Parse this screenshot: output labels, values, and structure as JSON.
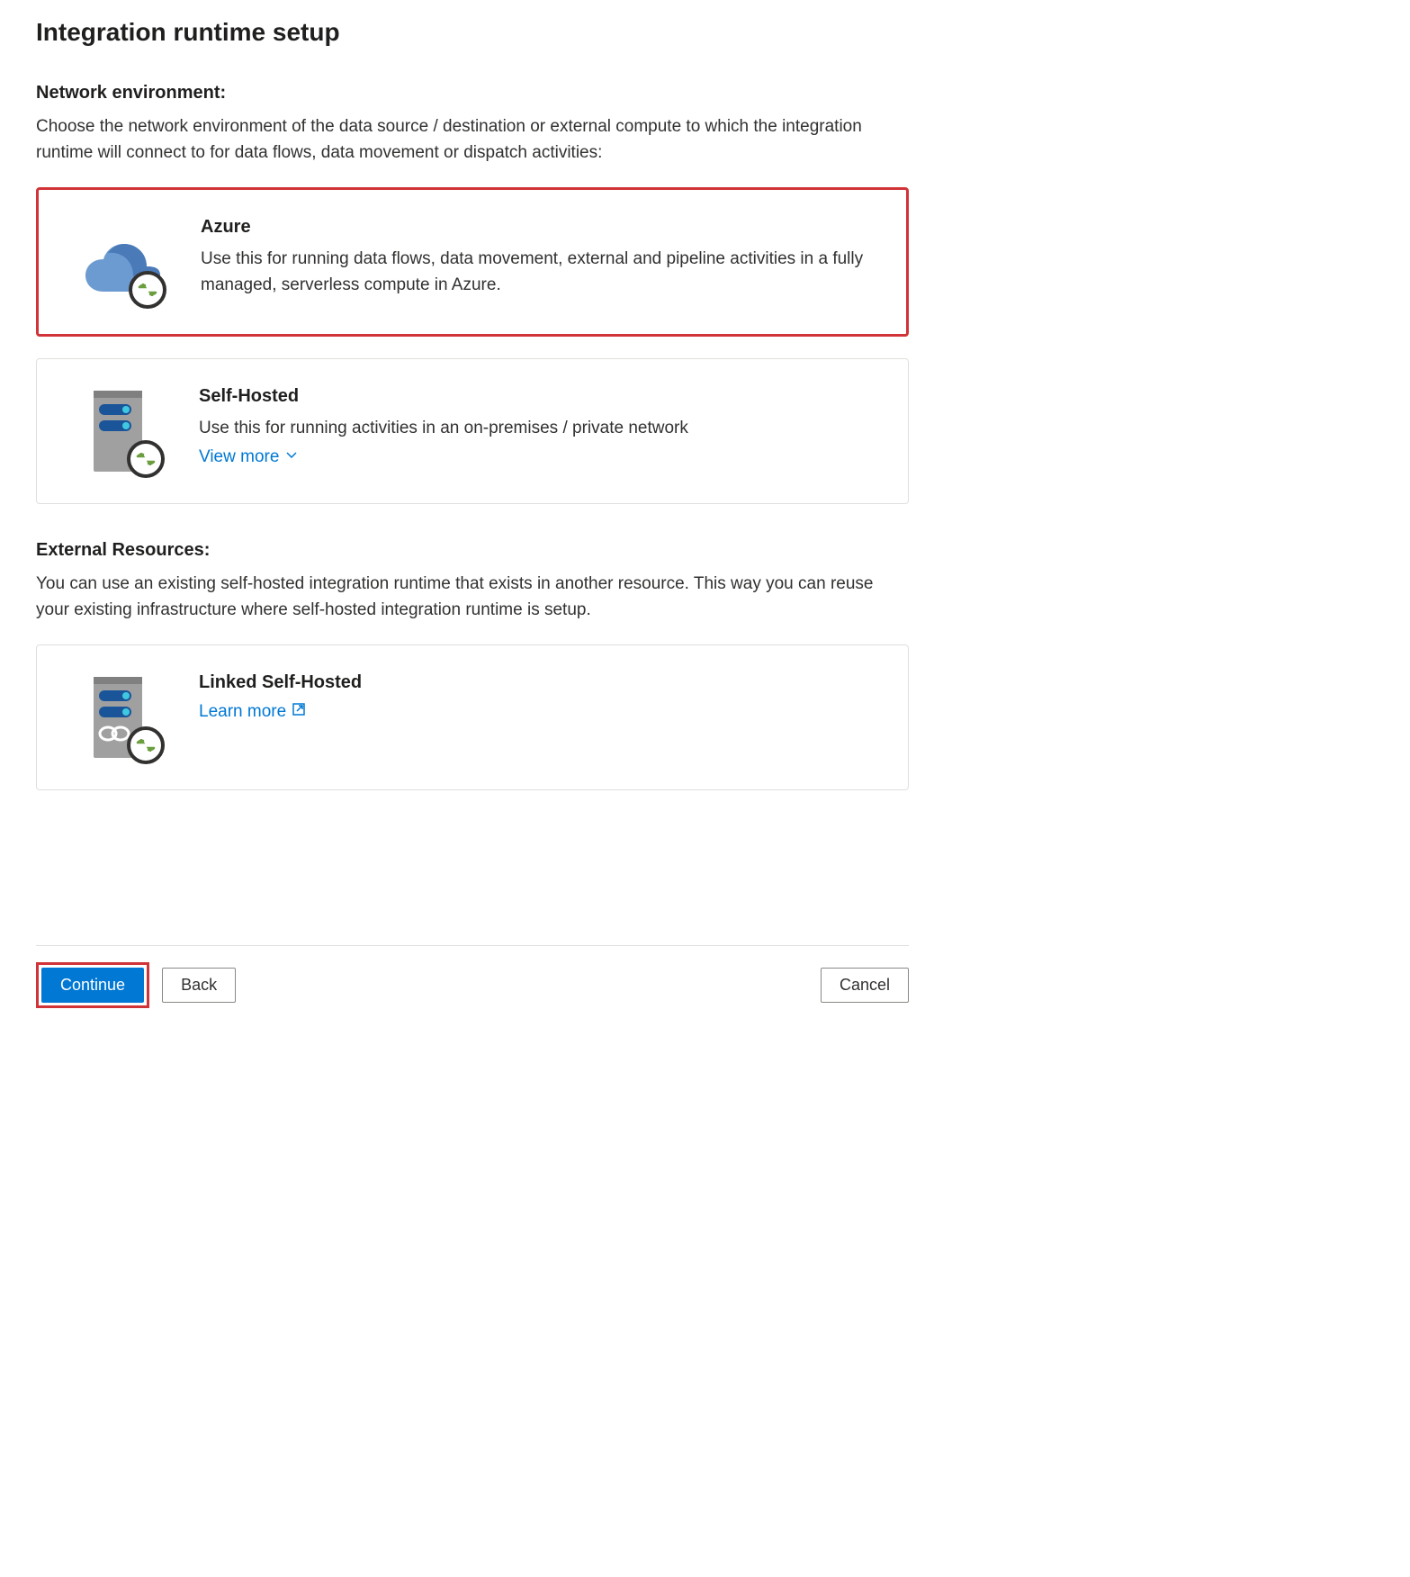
{
  "page": {
    "title": "Integration runtime setup"
  },
  "network": {
    "heading": "Network environment:",
    "description": "Choose the network environment of the data source / destination or external compute to which the integration runtime will connect to for data flows, data movement or dispatch activities:",
    "options": [
      {
        "title": "Azure",
        "description": "Use this for running data flows, data movement, external and pipeline activities in a fully managed, serverless compute in Azure."
      },
      {
        "title": "Self-Hosted",
        "description": "Use this for running activities in an on-premises / private network",
        "view_more": "View more"
      }
    ]
  },
  "external": {
    "heading": "External Resources:",
    "description": "You can use an existing self-hosted integration runtime that exists in another resource. This way you can reuse your existing infrastructure where self-hosted integration runtime is setup.",
    "options": [
      {
        "title": "Linked Self-Hosted",
        "learn_more": "Learn more"
      }
    ]
  },
  "footer": {
    "continue": "Continue",
    "back": "Back",
    "cancel": "Cancel"
  }
}
